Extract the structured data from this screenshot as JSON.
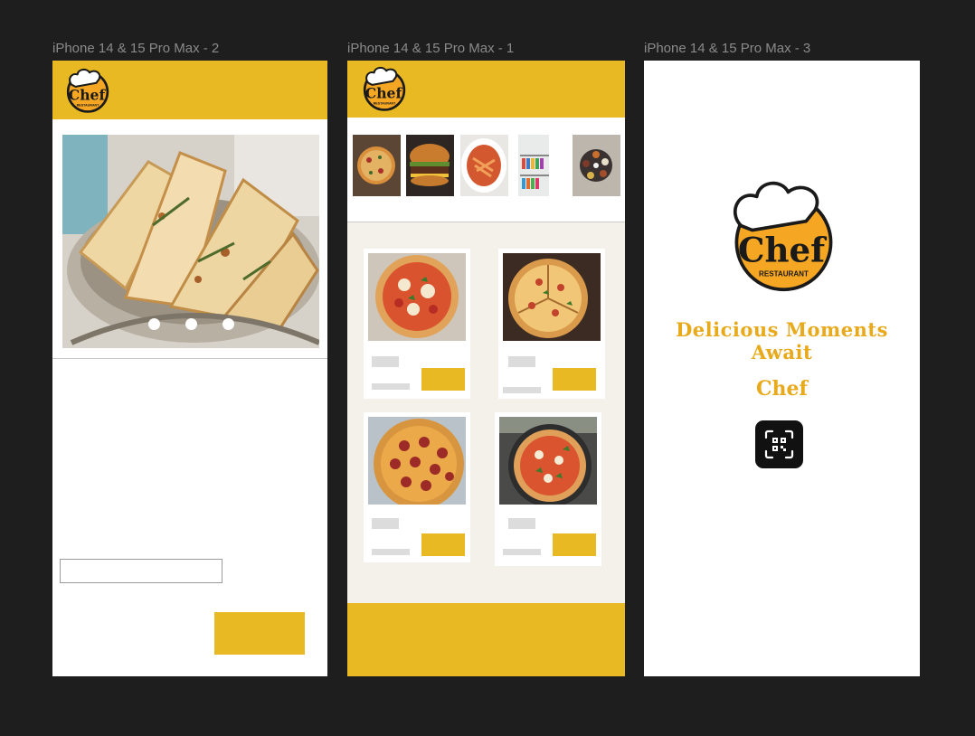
{
  "frames": {
    "frame2": {
      "label": "iPhone 14 & 15 Pro Max - 2",
      "carousel_count": 3
    },
    "frame1": {
      "label": "iPhone 14 & 15 Pro Max - 1",
      "category_count": 5,
      "product_count": 4
    },
    "frame3": {
      "label": "iPhone 14 & 15 Pro Max - 3",
      "tagline": "Delicious Moments Await",
      "app_name": "Chef"
    }
  },
  "logo": {
    "wordmark": "Chef",
    "subtext": "RESTAURANT"
  },
  "colors": {
    "brand": "#e8b923",
    "accent_text": "#e8a91a",
    "canvas": "#1e1e1e",
    "menu_bg": "#f4f1ea"
  },
  "icons": [
    "chef-hat-icon",
    "qr-scan-icon"
  ]
}
